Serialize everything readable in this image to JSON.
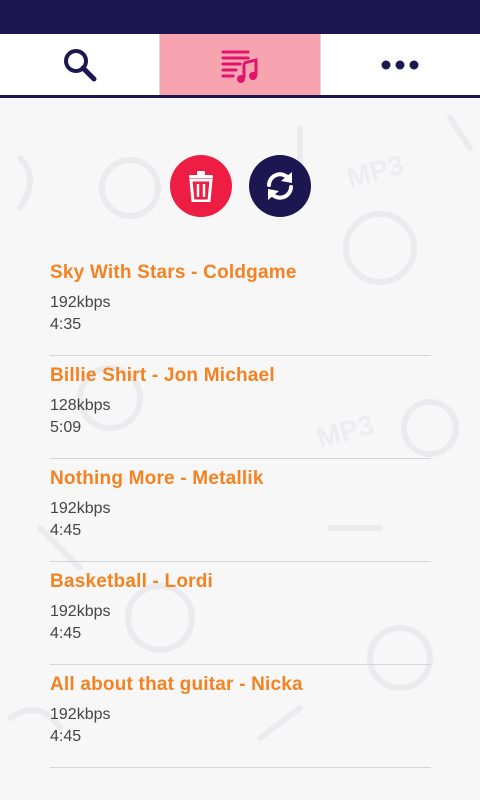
{
  "tabs": [
    {
      "name": "search",
      "icon": "search-icon"
    },
    {
      "name": "playlist",
      "icon": "playlist-music-icon",
      "active": true
    },
    {
      "name": "more",
      "icon": "more-dots-icon"
    }
  ],
  "actions": {
    "delete_icon": "trash-icon",
    "refresh_icon": "refresh-icon"
  },
  "tracks": [
    {
      "title": "Sky With Stars - Coldgame",
      "bitrate": "192kbps",
      "duration": "4:35"
    },
    {
      "title": "Billie Shirt - Jon Michael",
      "bitrate": "128kbps",
      "duration": "5:09"
    },
    {
      "title": "Nothing More - Metallik",
      "bitrate": "192kbps",
      "duration": "4:45"
    },
    {
      "title": "Basketball - Lordi",
      "bitrate": "192kbps",
      "duration": "4:45"
    },
    {
      "title": "All about that guitar - Nicka",
      "bitrate": "192kbps",
      "duration": "4:45"
    }
  ],
  "colors": {
    "header": "#1c1750",
    "active_tab": "#f7a4b0",
    "accent_orange": "#f58220",
    "delete_red": "#ee1d44"
  }
}
